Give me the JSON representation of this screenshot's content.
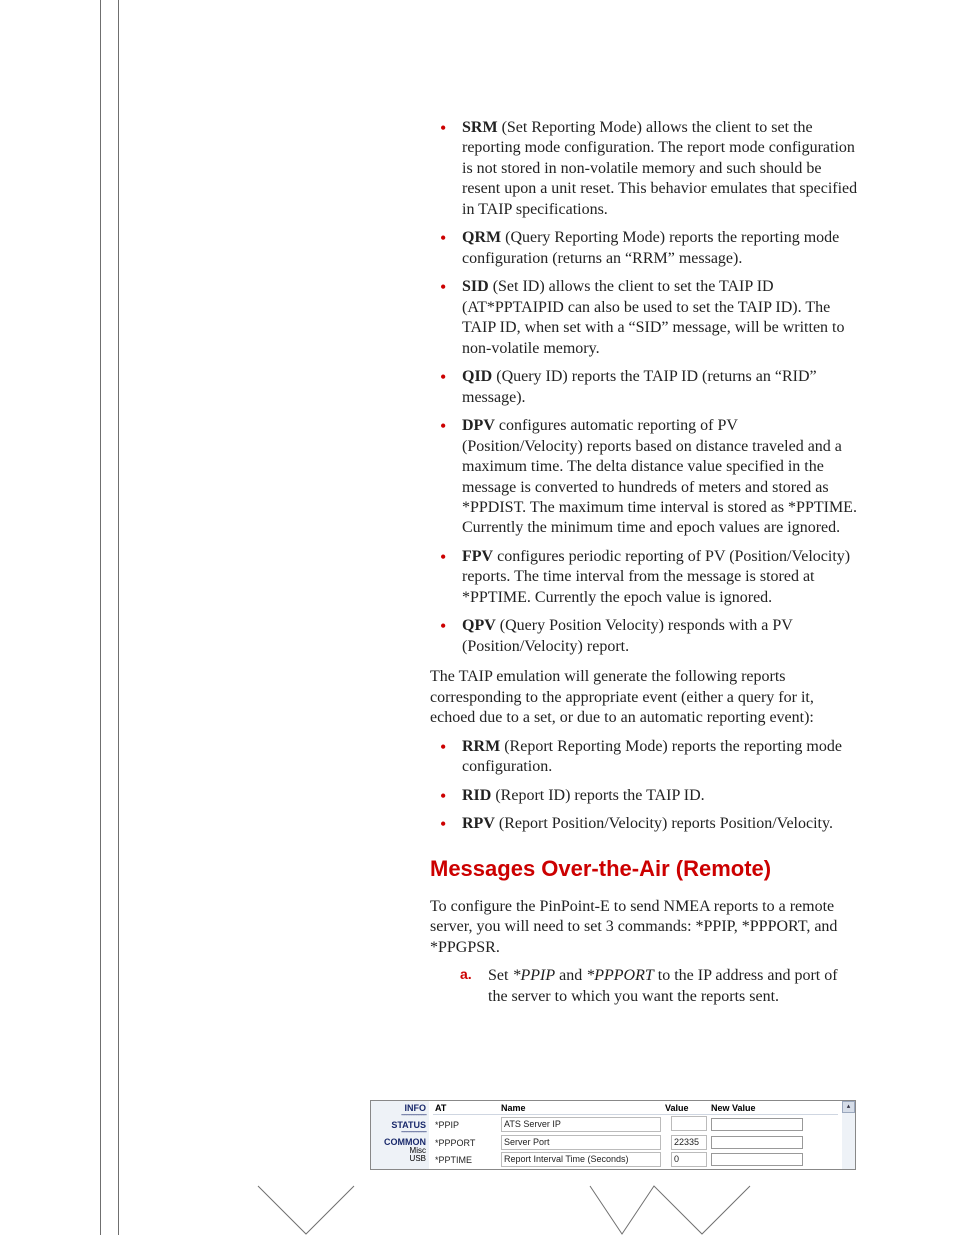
{
  "bullets1": [
    {
      "term": "SRM",
      "text": " (Set Reporting Mode) allows the client to set the reporting mode configuration. The report mode configuration is not stored in non-volatile memory and such should be resent upon a unit reset. This behavior emulates that specified in TAIP specifications."
    },
    {
      "term": "QRM",
      "text": " (Query Reporting Mode) reports the reporting mode configuration (returns an “RRM” message)."
    },
    {
      "term": "SID",
      "text": " (Set ID) allows the client to set the TAIP ID (AT*PPTAIPID can also be used to set the TAIP ID). The TAIP ID, when set with a “SID” message, will be written to non-volatile memory."
    },
    {
      "term": "QID",
      "text": " (Query ID) reports the TAIP ID (returns an “RID” message)."
    },
    {
      "term": "DPV",
      "text": " configures automatic reporting of PV (Position/Velocity) reports based on distance traveled and a maximum time. The delta distance value specified in the message is converted to hundreds of meters and stored as *PPDIST. The maximum time interval is stored as *PPTIME. Currently the minimum time and epoch values are ignored."
    },
    {
      "term": "FPV",
      "text": " configures periodic reporting of PV (Position/Velocity) reports. The time interval from the message is stored at *PPTIME. Currently the epoch value is ignored."
    },
    {
      "term": "QPV",
      "text": " (Query Position Velocity) responds with a PV (Position/Velocity) report."
    }
  ],
  "middle_para": "The TAIP emulation will generate the following reports corresponding to the appropriate event (either a query for it, echoed due to a set, or due to an automatic reporting event):",
  "bullets2": [
    {
      "term": "RRM",
      "text": " (Report Reporting Mode) reports the reporting mode configuration."
    },
    {
      "term": "RID",
      "text": " (Report ID) reports the TAIP ID."
    },
    {
      "term": "RPV",
      "text": " (Report Position/Velocity) reports Position/Velocity."
    }
  ],
  "section_heading": "Messages Over-the-Air (Remote)",
  "remote_para": "To configure the PinPoint-E to send NMEA reports to a remote server, you will need to set 3 commands: *PPIP, *PPPORT, and *PPGPSR.",
  "step_a_marker": "a.",
  "step_a_lead": "Set ",
  "step_a_i1": "*PPIP",
  "step_a_mid": " and ",
  "step_a_i2": "*PPPORT",
  "step_a_tail": " to the IP address and port of the server to which you want the reports sent.",
  "config_panel": {
    "sidebar": {
      "info": "INFO",
      "status": "STATUS",
      "common": "COMMON",
      "misc": "Misc",
      "usb": "USB"
    },
    "headers": {
      "at": "AT",
      "name": "Name",
      "value": "Value",
      "newvalue": "New Value"
    },
    "rows": [
      {
        "at": "*PPIP",
        "name": "ATS Server IP",
        "value": "",
        "newvalue": ""
      },
      {
        "at": "*PPPORT",
        "name": "Server Port",
        "value": "22335",
        "newvalue": ""
      },
      {
        "at": "*PPTIME",
        "name": "Report Interval Time (Seconds)",
        "value": "0",
        "newvalue": ""
      }
    ]
  }
}
